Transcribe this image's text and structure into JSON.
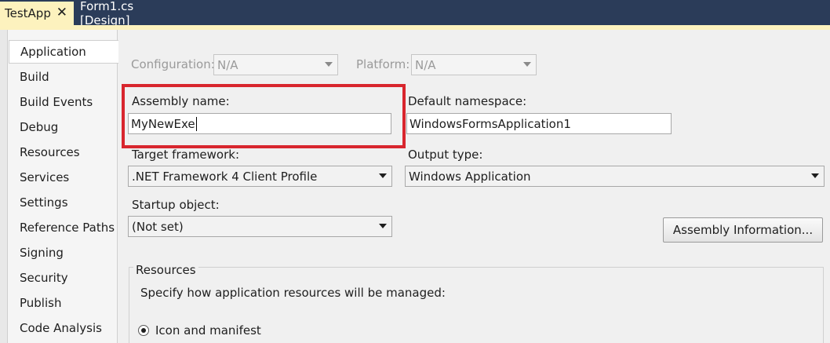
{
  "tabs": {
    "active_label": "TestApp",
    "close_glyph": "✕",
    "inactive_label": "Form1.cs [Design]"
  },
  "nav": {
    "items": [
      "Application",
      "Build",
      "Build Events",
      "Debug",
      "Resources",
      "Services",
      "Settings",
      "Reference Paths",
      "Signing",
      "Security",
      "Publish",
      "Code Analysis"
    ],
    "selected": "Application"
  },
  "form": {
    "configuration_label": "Configuration:",
    "configuration_value": "N/A",
    "platform_label": "Platform:",
    "platform_value": "N/A",
    "assembly_name_label": "Assembly name:",
    "assembly_name_value": "MyNewExe",
    "default_namespace_label": "Default namespace:",
    "default_namespace_value": "WindowsFormsApplication1",
    "target_framework_label": "Target framework:",
    "target_framework_value": ".NET Framework 4 Client Profile",
    "output_type_label": "Output type:",
    "output_type_value": "Windows Application",
    "startup_object_label": "Startup object:",
    "startup_object_value": "(Not set)",
    "assembly_info_button": "Assembly Information...",
    "resources_group_title": "Resources",
    "resources_description": "Specify how application resources will be managed:",
    "icon_manifest_option": "Icon and manifest"
  },
  "colors": {
    "tab_bar": "#2b3c59",
    "active_tab": "#fdf2be",
    "highlight": "#d8262e"
  }
}
